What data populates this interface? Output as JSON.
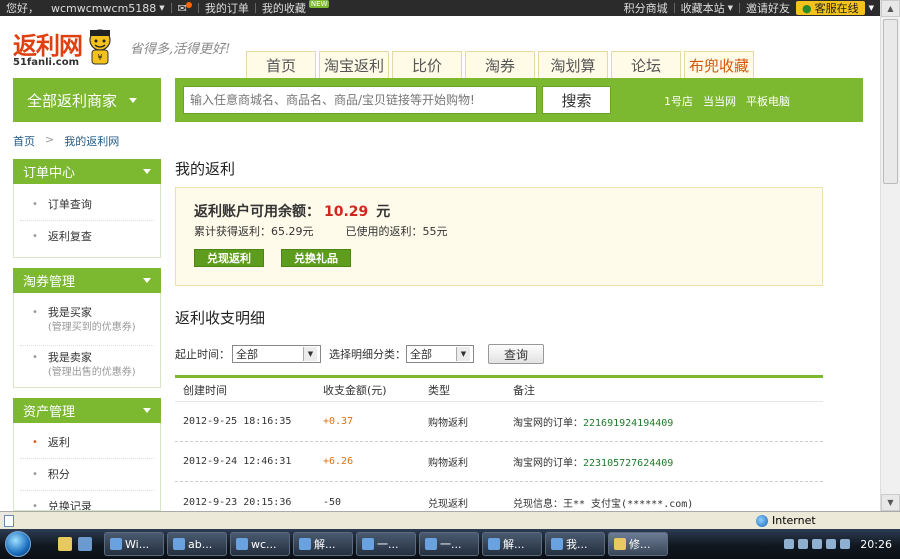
{
  "topbar": {
    "greeting": "您好，",
    "username": "wcmwcmwcm5188",
    "my_orders": "我的订单",
    "my_favorites": "我的收藏",
    "new_badge": "NEW",
    "points_mall": "积分商城",
    "bookmark_site": "收藏本站",
    "invite_friends": "邀请好友",
    "customer_service": "客服在线"
  },
  "header": {
    "logo_text": "返利网",
    "logo_domain": "51fanli.com",
    "slogan": "省得多,活得更好!",
    "nav_tabs": [
      "首页",
      "淘宝返利",
      "比价",
      "淘券",
      "淘划算",
      "论坛",
      "布兜收藏"
    ],
    "all_merchants": "全部返利商家",
    "search_placeholder": "输入任意商城名、商品名、商品/宝贝链接等开始购物!",
    "search_button": "搜索",
    "quick_links": [
      "1号店",
      "当当网",
      "平板电脑"
    ]
  },
  "breadcrumb": [
    "首页",
    "我的返利网"
  ],
  "sidebar": {
    "sections": [
      {
        "title": "订单中心",
        "items": [
          {
            "label": "订单查询"
          },
          {
            "label": "返利复查"
          }
        ]
      },
      {
        "title": "淘券管理",
        "items": [
          {
            "label": "我是买家",
            "sub": "(管理买到的优惠券)"
          },
          {
            "label": "我是卖家",
            "sub": "(管理出售的优惠券)"
          }
        ]
      },
      {
        "title": "资产管理",
        "items": [
          {
            "label": "返利"
          },
          {
            "label": "积分"
          },
          {
            "label": "兑换记录"
          }
        ]
      }
    ]
  },
  "main": {
    "title": "我的返利",
    "balance_label": "返利账户可用余额：",
    "balance_amount": "10.29",
    "balance_unit": "元",
    "total_earned": "累计获得返利：65.29元",
    "total_used": "已使用的返利：55元",
    "redeem_rebate_button": "兑现返利",
    "redeem_gift_button": "兑换礼品",
    "detail_title": "返利收支明细",
    "filter_time_label": "起止时间：",
    "filter_time_value": "全部",
    "filter_category_label": "选择明细分类：",
    "filter_category_value": "全部",
    "query_button": "查询",
    "table": {
      "headers": [
        "创建时间",
        "收支金额(元)",
        "类型",
        "备注"
      ],
      "rows": [
        {
          "time": "2012-9-25 18:16:35",
          "amount": "+0.37",
          "type": "购物返利",
          "note_prefix": "淘宝网的订单：",
          "note_id": "221691924194409"
        },
        {
          "time": "2012-9-24 12:46:31",
          "amount": "+6.26",
          "type": "购物返利",
          "note_prefix": "淘宝网的订单：",
          "note_id": "223105727624409"
        },
        {
          "time": "2012-9-23 20:15:36",
          "amount": "-50",
          "type": "兑现返利",
          "note_prefix": "兑现信息：王** 支付宝(******.com)",
          "note_id": ""
        }
      ]
    }
  },
  "statusbar": {
    "zone": "Internet"
  },
  "taskbar": {
    "tasks": [
      "Wi...",
      "ab...",
      "wc...",
      "解...",
      "一...",
      "一...",
      "解...",
      "我...",
      "修..."
    ],
    "clock": "20:26"
  }
}
